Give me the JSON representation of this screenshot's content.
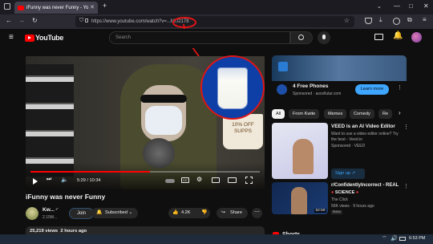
{
  "browser": {
    "tab_title": "iFunny was never Funny - Yo",
    "url_text": "https://www.youtube.com/watch?v=...MU2178"
  },
  "youtube": {
    "logo_text": "YouTube",
    "search_placeholder": "Search"
  },
  "player": {
    "time": "5:29 / 10:34",
    "progress_fraction": 0.52,
    "cup_label": "10% OFF SUPPS"
  },
  "video": {
    "title": "iFunny was never Funny",
    "channel_name": "Kw...",
    "subscribers": "2.15M...",
    "join_label": "Join",
    "subscribed_label": "Subscribed",
    "like_count": "4.2K",
    "share_label": "Share",
    "views_line": "25,219 views  2 hours ago"
  },
  "sidebar": {
    "ad": {
      "title": "4 Free Phones",
      "sponsor": "Sponsored · ascellular.com",
      "cta": "Learn more"
    },
    "chips": [
      "All",
      "From Kwite",
      "Memes",
      "Comedy",
      "Re"
    ],
    "rec1": {
      "title": "VEED is an AI Video Editor",
      "desc": "Want to use a video editor online? Try the best - Veed.io",
      "sponsor": "Sponsored · VEED",
      "signup": "Sign up"
    },
    "rec2": {
      "title": "r/ConfidentlyIncorrect - REAL",
      "channel": "SCIENCE",
      "source": "The Click",
      "meta": "56K views · 9 hours ago",
      "badge": "New",
      "duration": "52:59"
    },
    "shorts_label": "Shorts"
  },
  "taskbar": {
    "time": "6:53 PM"
  }
}
